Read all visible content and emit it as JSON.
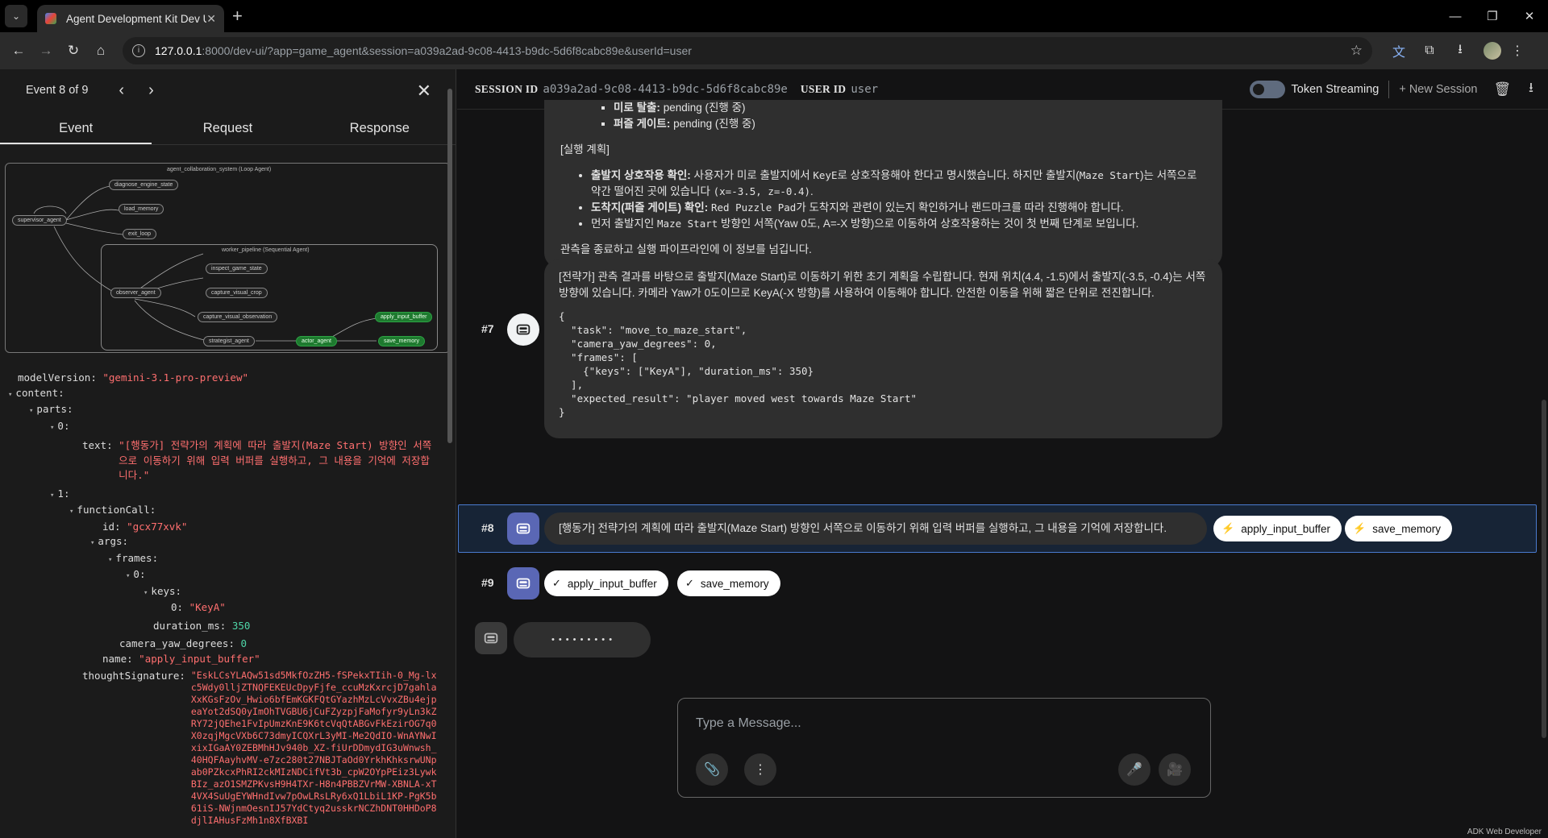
{
  "browser": {
    "tab_title": "Agent Development Kit Dev UI",
    "url_host": "127.0.0.1",
    "url_rest": ":8000/dev-ui/?app=game_agent&session=a039a2ad-9c08-4413-b9dc-5d6f8cabc89e&userId=user"
  },
  "left": {
    "event_label": "Event 8 of 9",
    "tabs": [
      "Event",
      "Request",
      "Response"
    ],
    "graph": {
      "loop_title": "agent_collaboration_system (Loop Agent)",
      "seq_title": "worker_pipeline (Sequential Agent)",
      "nodes": [
        "diagnose_engine_state",
        "load_memory",
        "supervisor_agent",
        "exit_loop",
        "inspect_game_state",
        "observer_agent",
        "capture_visual_crop",
        "capture_visual_observation",
        "apply_input_buffer",
        "strategist_agent",
        "actor_agent",
        "save_memory"
      ]
    },
    "json": {
      "modelVersion_key": "modelVersion",
      "modelVersion_val": "\"gemini-3.1-pro-preview\"",
      "content_key": "content:",
      "parts_key": "parts:",
      "idx0": "0:",
      "text_key": "text:",
      "text_val": "\"[행동가] 전략가의 계획에 따라 출발지(Maze Start) 방향인 서쪽으로 이동하기 위해 입력 버퍼를 실행하고, 그 내용을 기억에 저장합니다.\"",
      "idx1": "1:",
      "fc_key": "functionCall:",
      "id_key": "id:",
      "id_val": "\"gcx77xvk\"",
      "args_key": "args:",
      "frames_key": "frames:",
      "f0": "0:",
      "keys_key": "keys:",
      "k0": "0:",
      "k0_val": "\"KeyA\"",
      "dur_key": "duration_ms:",
      "dur_val": "350",
      "cam_key": "camera_yaw_degrees:",
      "cam_val": "0",
      "name_key": "name:",
      "name_val": "\"apply_input_buffer\"",
      "ts_key": "thoughtSignature:",
      "ts_val": "\"EskLCsYLAQw51sd5MkfOzZH5-fSPekxTIih-0_Mg-lxc5Wdy0lljZTNQFEKEUcDpyFjfe_ccuMzKxrcjD7gahlaXxKGsFzOv_Hwio6bfEmKGKFQtGYazhMzLcVvxZBu4ejpeaYot2dSQ0yImOhTVGBU6jCuFZyzpjFaMofyr9yLn3kZRY72jQEhe1FvIpUmzKnE9K6tcVqQtABGvFkEzirOG7q0X0zqjMgcVXb6C73dmyICQXrL3yMI-Me2QdIO-WnAYNwIxixIGaAY0ZEBMhHJv940b_XZ-fiUrDDmydIG3uWnwsh_40HQFAayhvMV-e7zc280t27NBJTaOd0YrkhKhksrwUNpab0PZkcxPhRI2ckMIzNDCifVt3b_cpW2OYpPEiz3LywkBIz_azO1SMZPKvsH9H4TXr-H8n4PBBZVrMW-XBNLA-xT4VX4SuUgEYWHndIvw7pOwLRsLRy6xQ1LbiL1KP-PgK5b61iS-NWjnmOesnIJ57YdCtyq2usskrNCZhDNT0HHDoP8djlIAHusFzMh1n8XfBXBI"
    }
  },
  "right": {
    "session_id_label": "SESSION ID",
    "session_id": "a039a2ad-9c08-4413-b9dc-5d6f8cabc89e",
    "user_id_label": "USER ID",
    "user_id": "user",
    "token_streaming": "Token Streaming",
    "new_session": "New Session",
    "top_bubble": {
      "b1_label": "미로 탈출:",
      "b1_text": " pending (진행 중)",
      "b2_label": "퍼즐 게이트:",
      "b2_text": " pending (진행 중)",
      "plan_heading": "[실행 계획]",
      "p1_label": "출발지 상호작용 확인:",
      "p1_text_a": " 사용자가 미로 출발지에서 ",
      "p1_code_a": "KeyE",
      "p1_text_b": "로 상호작용해야 한다고 명시했습니다. 하지만 출발지(",
      "p1_code_b": "Maze Start",
      "p1_text_c": ")는 서쪽으로 약간 떨어진 곳에 있습니다 ",
      "p1_code_c": "(x=-3.5, z=-0.4)",
      "p1_text_d": ".",
      "p2_label": "도착지(퍼즐 게이트) 확인:",
      "p2_text_a": " ",
      "p2_code": "Red Puzzle Pad",
      "p2_text_b": "가 도착지와 관련이 있는지 확인하거나 랜드마크를 따라 진행해야 합니다.",
      "p3_text_a": "먼저 출발지인 ",
      "p3_code": "Maze Start",
      "p3_text_b": " 방향인 서쪽(Yaw 0도, A=-X 방향)으로 이동하여 상호작용하는 것이 첫 번째 단계로 보입니다.",
      "closing": "관측을 종료하고 실행 파이프라인에 이 정보를 넘깁니다."
    },
    "msg7": {
      "label": "#7",
      "text": "[전략가] 관측 결과를 바탕으로 출발지(Maze Start)로 이동하기 위한 초기 계획을 수립합니다. 현재 위치(4.4, -1.5)에서 출발지(-3.5, -0.4)는 서쪽 방향에 있습니다. 카메라 Yaw가 0도이므로 KeyA(-X 방향)를 사용하여 이동해야 합니다. 안전한 이동을 위해 짧은 단위로 전진합니다.",
      "code": "{\n  \"task\": \"move_to_maze_start\",\n  \"camera_yaw_degrees\": 0,\n  \"frames\": [\n    {\"keys\": [\"KeyA\"], \"duration_ms\": 350}\n  ],\n  \"expected_result\": \"player moved west towards Maze Start\"\n}"
    },
    "msg8": {
      "label": "#8",
      "text": "[행동가] 전략가의 계획에 따라 출발지(Maze Start) 방향인 서쪽으로 이동하기 위해 입력 버퍼를 실행하고, 그 내용을 기억에 저장합니다.",
      "chip1": "apply_input_buffer",
      "chip2": "save_memory"
    },
    "msg9": {
      "label": "#9",
      "chip1": "apply_input_buffer",
      "chip2": "save_memory"
    },
    "typing": "• • • • • • • • •",
    "composer_placeholder": "Type a Message...",
    "footer": "ADK Web Developer"
  }
}
